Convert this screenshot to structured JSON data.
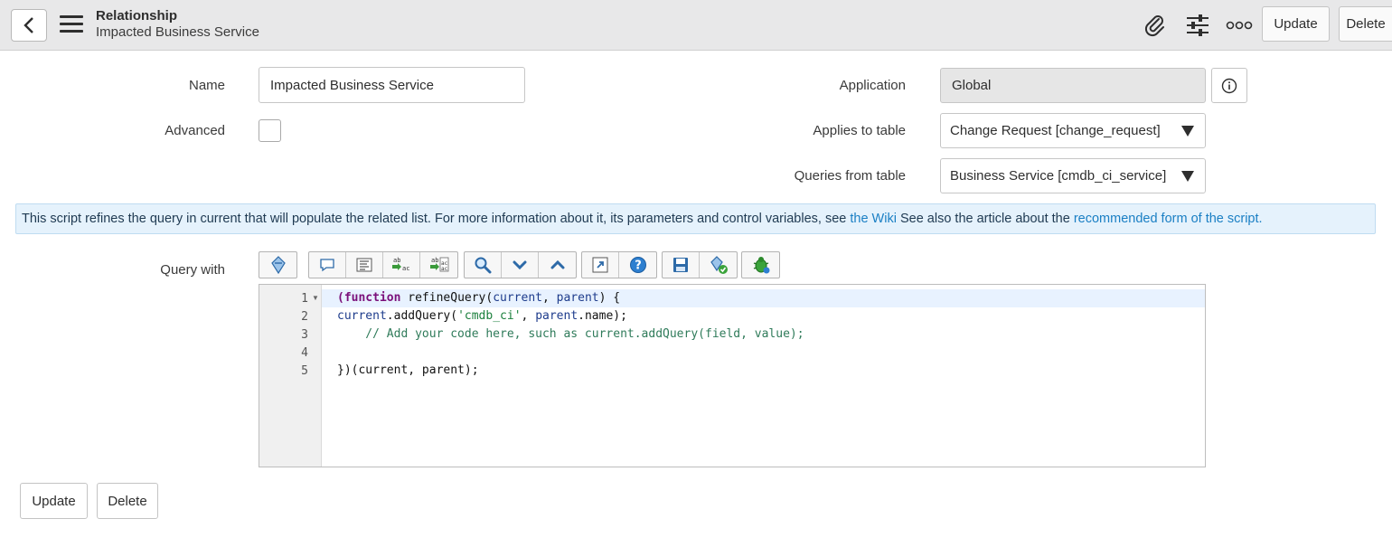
{
  "header": {
    "title": "Relationship",
    "subtitle": "Impacted Business Service",
    "update_label": "Update",
    "delete_label": "Delete"
  },
  "form": {
    "name_label": "Name",
    "name_value": "Impacted Business Service",
    "advanced_label": "Advanced",
    "application_label": "Application",
    "application_value": "Global",
    "applies_to_label": "Applies to table",
    "applies_to_value": "Change Request [change_request]",
    "queries_from_label": "Queries from table",
    "queries_from_value": "Business Service [cmdb_ci_service]",
    "query_with_label": "Query with"
  },
  "banner": {
    "text_before": "This script refines the query in current that will populate the related list. For more information about it, its parameters and control variables, see ",
    "wiki_link": "the Wiki",
    "text_middle": " See also the article about the ",
    "form_link": "recommended form of the script."
  },
  "editor": {
    "line_numbers": [
      "1",
      "2",
      "3",
      "4",
      "5"
    ],
    "line1": {
      "kw": "(function",
      "fn": " refineQuery(",
      "p1": "current",
      "sep": ", ",
      "p2": "parent",
      "end": ") {"
    },
    "line2": {
      "obj": "current",
      "call": ".addQuery(",
      "str": "'cmdb_ci'",
      "sep": ", ",
      "p2": "parent",
      "end": ".name);"
    },
    "line3": "    // Add your code here, such as current.addQuery(field, value);",
    "line5": "})(current, parent);"
  },
  "footer": {
    "update_label": "Update",
    "delete_label": "Delete"
  }
}
